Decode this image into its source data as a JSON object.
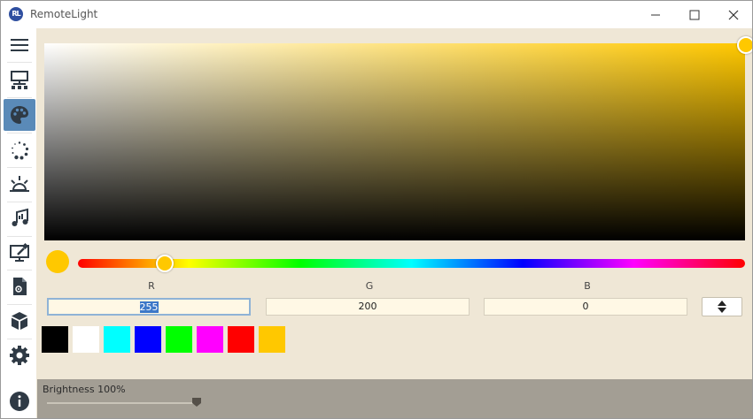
{
  "window": {
    "title": "RemoteLight",
    "logo_text": "RL"
  },
  "sidebar": {
    "items": [
      {
        "icon": "menu-icon",
        "active": false
      },
      {
        "icon": "devices-icon",
        "active": false
      },
      {
        "icon": "palette-icon",
        "active": true
      },
      {
        "icon": "animation-icon",
        "active": false
      },
      {
        "icon": "scenes-icon",
        "active": false
      },
      {
        "icon": "music-sync-icon",
        "active": false
      },
      {
        "icon": "screen-color-icon",
        "active": false
      },
      {
        "icon": "scripts-icon",
        "active": false
      },
      {
        "icon": "plugins-icon",
        "active": false
      },
      {
        "icon": "settings-icon",
        "active": false
      },
      {
        "icon": "about-icon",
        "active": false
      }
    ]
  },
  "color_picker": {
    "current_color": "#FFC800",
    "channels": [
      {
        "label": "R",
        "value": "255"
      },
      {
        "label": "G",
        "value": "200"
      },
      {
        "label": "B",
        "value": "0"
      }
    ],
    "swatches": [
      "#000000",
      "#FFFFFF",
      "#00FFFF",
      "#0000FF",
      "#00FF00",
      "#FF00FF",
      "#FF0000",
      "#FFC800"
    ]
  },
  "brightness": {
    "label": "Brightness 100%",
    "value": 1.0
  },
  "colors": {
    "active_nav": "#5A8AB8",
    "background": "#EFE7D6",
    "bottom_bar": "#A39E94"
  }
}
